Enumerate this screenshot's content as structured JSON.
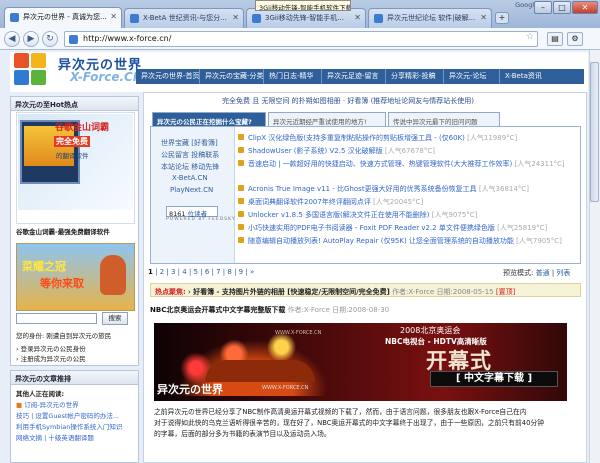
{
  "browser": {
    "tabs": [
      {
        "label": "异次元の世界 - 真诚为您..."
      },
      {
        "label": "X-BetA 世纪资讯-与您分..."
      },
      {
        "label": "3Gii移动先锋-智能手机..."
      },
      {
        "label": "异次元世纪论坛 软件|破解..."
      }
    ],
    "tooltip": "3Gii移动先锋-智能手机软件下载站",
    "google_label": "Google",
    "window_controls": {
      "minimize": "–",
      "maximize": "□",
      "close": "✕"
    },
    "url": "http://www.x-force.cn/",
    "new_tab": "+"
  },
  "site": {
    "logo_cn": "异次元の世界",
    "logo_en": "X-Force.CN",
    "nav": [
      "异次元の世界-首页",
      "异次元の宝藏-分类",
      "热门日志-精华",
      "异次元足迹-留言",
      "分享精彩-投稿",
      "异次元-论坛",
      "X-Beta资讯"
    ],
    "colors": {
      "nav_bg": "#2f5f9a",
      "accent": "#d62020",
      "link": "#3366cc"
    }
  },
  "sidebar": {
    "hot_title": "异次元の至Hot热点",
    "ad1": {
      "line1": "谷歌金山词霸",
      "line2": "完全免费",
      "line3": "的翻译软件",
      "caption": "谷歌金山词霸-最强免费翻译软件"
    },
    "ad2": {
      "line1": "菜耀之冠",
      "line2": "等你来取"
    },
    "search_button": "搜索",
    "identity": "您的身份: 刚遭自到异次元の旅民",
    "links": [
      "登录异次元の公民身份",
      "注册成为异次元の公民"
    ],
    "reading_title": "异次元の文章推排",
    "reading_sub": "其他人正在阅读:",
    "reading_items": [
      "订阅-异次元の世界",
      "技巧 | 设置Guest帐户密码的办法...",
      "利用手机Symbian操作系统入门知识",
      "网络文摘 | 十级英语翻译题"
    ]
  },
  "main": {
    "promo": "完全免费 且 无限空间 的扑朔如图相册 · 好看簿 (推荐地址论网友与情荐站长使用)",
    "tabs": [
      "异次元の公民正在挖掘什么宝藏?",
      "异次元近期经严重试使用的地方!",
      "传说中异次元最下的旧问问题"
    ],
    "side_links": [
      "世界宝藏 [好看簿]",
      "公民留言 投稿联系",
      "本站论坛 移动先锋",
      "X-BetA.CN",
      "PlayNext.CN"
    ],
    "counter_value": "8161",
    "counter_label": "位读者",
    "powered": "POWERED BY FEEDSKY",
    "items": [
      {
        "title": "ClipX 汉化绿色版(支持多重复制粘贴操作的剪贴板增强工具 - (仅60K)",
        "hits": "[人气11989°C]"
      },
      {
        "title": "ShadowUser (影子系统) V2.5 汉化破解版",
        "hits": "[人气67678°C]"
      },
      {
        "title": "音速启动 | 一款超好用的快捷启动、快速方式管理、热键管理软件(大大推荐工作效率)",
        "hits": "[人气24311°C]"
      },
      {
        "title": "Acronis True Image v11 - 比Ghost更强大好用的优秀系统备份恢复工具",
        "hits": "[人气36814°C]"
      },
      {
        "title": "桌面词典翻译软件2007年终评翻阅点评",
        "hits": "[人气20045°C]"
      },
      {
        "title": "Unlocker v1.8.5 多国语言版(解决文件正在使用不能删除)",
        "hits": "[人气9075°C]"
      },
      {
        "title": "小巧快速实用的PDF电子书阅读器 - Foxit PDF Reader v2.2 单文件便携绿色版",
        "hits": "[人气25819°C]"
      },
      {
        "title": "随意编辑自动播放列表! AutoPlay Repair (仅95K) 让您全面管理系统的自动播放功能",
        "hits": "[人气7905°C]"
      }
    ],
    "pager": {
      "current": "1",
      "pages": [
        "2",
        "3",
        "4",
        "5",
        "6",
        "7",
        "8",
        "9"
      ],
      "next": "»"
    },
    "preview_label": "预览模式:",
    "preview_normal": "普通",
    "preview_list": "列表",
    "hot": {
      "label": "热点聚焦:",
      "title": "好看簿 - 支持图片外链的相册 [快速稳定/无限制空间/完全免费]",
      "meta": "作者:X-Force 日期:2008-05-15",
      "pin": "[置顶]"
    },
    "article": {
      "title": "NBC北京奥运会开幕式中文字幕完整版下载",
      "meta": "作者:X-Force 日期:2008-08-30"
    },
    "banner": {
      "olympic": "2008北京奥运会",
      "channel": "NBC电视台 - HDTV高清晰版",
      "big": "开幕式",
      "sub": "[ 中文字幕下载 ]",
      "site": "异次元の世界",
      "url": "WWW.X-FORCE.CN",
      "watermark": "WWW.X-FORCE.CN"
    },
    "body": [
      "之前异次元の世界已经分享了NBC制作高清奥运开幕式视频的下载了，然而，由于语言问题，很多朋友也跟X-Force自己在内",
      "对于说得如此快的乌克兰语听得很辛苦的，现在好了，NBC奥运开幕式的中文字幕终于出现了，由于一些原因，之前只有前40分钟",
      "的字幕，后面的部分多为书籍的表演节目以及运动员入场。"
    ]
  }
}
